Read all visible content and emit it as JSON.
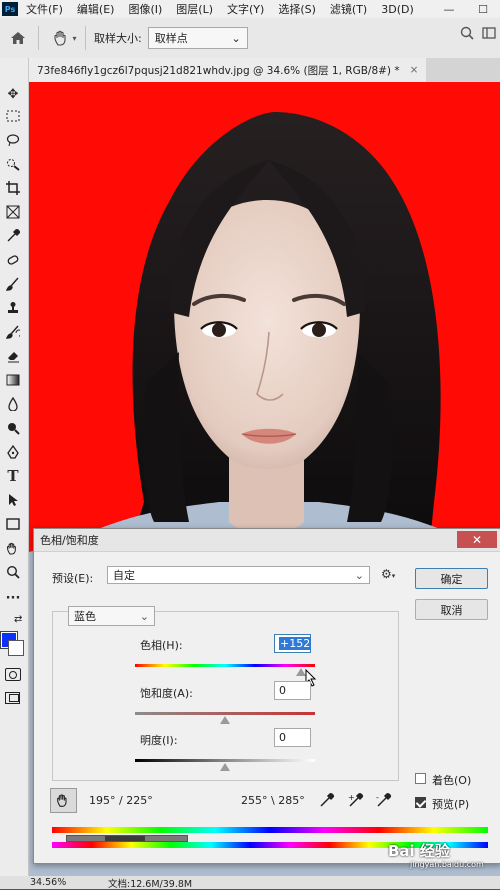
{
  "app": {
    "logo": "Ps"
  },
  "menu": [
    "文件(F)",
    "编辑(E)",
    "图像(I)",
    "图层(L)",
    "文字(Y)",
    "选择(S)",
    "滤镜(T)",
    "3D(D)"
  ],
  "window_controls": {
    "minimize": "—",
    "maximize": "☐"
  },
  "options_bar": {
    "home_icon": "home-icon",
    "tool_icon": "hand-eyedropper-icon",
    "sample_size_label": "取样大小:",
    "sample_size_value": "取样点",
    "right_icons": [
      "search-icon",
      "workspace-icon"
    ]
  },
  "document": {
    "tab_title": "73fe846fly1gcz6l7pqusj21d821whdv.jpg @ 34.6% (图层 1, RGB/8#) *",
    "close": "×",
    "background_color": "#ff0000"
  },
  "toolbar": {
    "tools": [
      "move-tool-icon",
      "marquee-tool-icon",
      "lasso-tool-icon",
      "quick-select-icon",
      "crop-tool-icon",
      "frame-tool-icon",
      "eyedropper-tool-icon",
      "healing-brush-icon",
      "brush-tool-icon",
      "clone-stamp-icon",
      "history-brush-icon",
      "eraser-tool-icon",
      "gradient-tool-icon",
      "blur-tool-icon",
      "dodge-tool-icon",
      "pen-tool-icon",
      "type-tool-icon",
      "path-select-icon",
      "rectangle-tool-icon",
      "hand-tool-icon",
      "zoom-tool-icon",
      "more-tools-icon"
    ],
    "foreground_color": "#0a31ff",
    "background_color": "#ffffff"
  },
  "status": {
    "zoom": "34.56%",
    "doc_size": "文档:12.6M/39.8M"
  },
  "watermark": {
    "text": "Bai 经验",
    "url": "jingyan.baidu.com"
  },
  "dialog": {
    "title": "色相/饱和度",
    "close_label": "✕",
    "preset_label": "预设(E):",
    "preset_value": "自定",
    "ok_label": "确定",
    "cancel_label": "取消",
    "channel_value": "蓝色",
    "hue_label": "色相(H):",
    "hue_value": "+152",
    "saturation_label": "饱和度(A):",
    "saturation_value": "0",
    "lightness_label": "明度(I):",
    "lightness_value": "0",
    "colorize_label": "着色(O)",
    "colorize_checked": false,
    "preview_label": "预览(P)",
    "preview_checked": true,
    "range_left": "195° / 225°",
    "range_right": "255° \\ 285°",
    "hue_slider_fraction": 0.92,
    "saturation_slider_fraction": 0.5,
    "lightness_slider_fraction": 0.5
  }
}
